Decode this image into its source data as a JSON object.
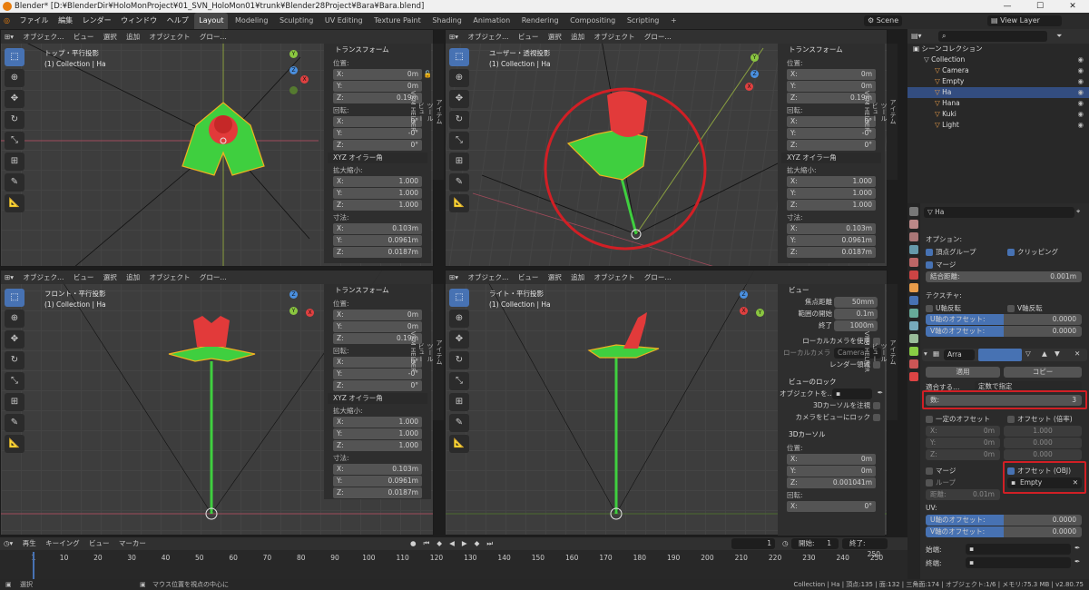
{
  "titlebar": {
    "title": "Blender* [D:¥BlenderDir¥HoloMonProject¥01_SVN_HoloMon01¥trunk¥Blender28Project¥Bara¥Bara.blend]",
    "minimize": "—",
    "maximize": "☐",
    "close": "✕"
  },
  "menubar": {
    "menus": [
      "ファイル",
      "編集",
      "レンダー",
      "ウィンドウ",
      "ヘルプ"
    ],
    "tabs": [
      "Layout",
      "Modeling",
      "Sculpting",
      "UV Editing",
      "Texture Paint",
      "Shading",
      "Animation",
      "Rendering",
      "Compositing",
      "Scripting"
    ],
    "add_tab": "+",
    "scene": "Scene",
    "view_layer": "View Layer"
  },
  "viewport_header": {
    "mode": "オブジェク…",
    "mode_long": "オブジェクト…",
    "view": "ビュー",
    "select": "選択",
    "add": "追加",
    "object": "オブジェクト",
    "orientation": "グロー…",
    "pivot": "グロー…"
  },
  "viewports": {
    "tl": {
      "title": "トップ・平行投影",
      "collection": "(1) Collection | Ha"
    },
    "tr": {
      "title": "ユーザー・透視投影",
      "collection": "(1) Collection | Ha"
    },
    "bl": {
      "title": "フロント・平行投影",
      "collection": "(1) Collection | Ha"
    },
    "br": {
      "title": "ライト・平行投影",
      "collection": "(1) Collection | Ha"
    }
  },
  "transform_panel": {
    "header": "トランスフォーム",
    "location_label": "位置:",
    "location": [
      {
        "k": "X:",
        "v": "0m"
      },
      {
        "k": "Y:",
        "v": "0m"
      },
      {
        "k": "Z:",
        "v": "0.19m"
      }
    ],
    "rotation_label": "回転:",
    "rotation": [
      {
        "k": "X:",
        "v": "0°"
      },
      {
        "k": "Y:",
        "v": "-0°"
      },
      {
        "k": "Z:",
        "v": "0°"
      }
    ],
    "rotation_mode": "XYZ オイラー角",
    "scale_label": "拡大縮小:",
    "scale": [
      {
        "k": "X:",
        "v": "1.000"
      },
      {
        "k": "Y:",
        "v": "1.000"
      },
      {
        "k": "Z:",
        "v": "1.000"
      }
    ],
    "dimensions_label": "寸法:",
    "dimensions": [
      {
        "k": "X:",
        "v": "0.103m"
      },
      {
        "k": "Y:",
        "v": "0.0961m"
      },
      {
        "k": "Z:",
        "v": "0.0187m"
      }
    ]
  },
  "side_tabs": {
    "item": "アイテム",
    "tool": "ツール",
    "view": "ビュー",
    "vrm": "VRM HELPER"
  },
  "view_panel": {
    "header": "ビュー",
    "focal_label": "焦点距離",
    "focal": "50mm",
    "clip_start_label": "範囲の開始",
    "clip_start": "0.1m",
    "clip_end_label": "終了",
    "clip_end": "1000m",
    "local_camera_label": "ローカルカメラを使用",
    "local_camera_field_label": "ローカルカメラ",
    "local_camera_value": "Camera",
    "render_region_label": "レンダー領域",
    "lock_header": "ビューのロック",
    "lock_object_label": "オブジェクトを…",
    "lock_cursor_label": "3Dカーソルを注視",
    "lock_camera_label": "カメラをビューにロック",
    "cursor_header": "3Dカーソル",
    "cursor_location_label": "位置:",
    "cursor_location": [
      {
        "k": "X:",
        "v": "0m"
      },
      {
        "k": "Y:",
        "v": "0m"
      },
      {
        "k": "Z:",
        "v": "0.001041m"
      }
    ],
    "cursor_rotation_label": "回転:",
    "cursor_rotation": [
      {
        "k": "X:",
        "v": "0°"
      }
    ]
  },
  "timeline": {
    "playback": "再生",
    "keying": "キーイング",
    "view": "ビュー",
    "marker": "マーカー",
    "current_frame": "1",
    "start_label": "開始:",
    "start": "1",
    "end_label": "終了:",
    "end": "250",
    "ticks": [
      "1",
      "10",
      "20",
      "30",
      "40",
      "50",
      "60",
      "70",
      "80",
      "90",
      "100",
      "110",
      "120",
      "130",
      "140",
      "150",
      "160",
      "170",
      "180",
      "190",
      "200",
      "210",
      "220",
      "230",
      "240",
      "250"
    ]
  },
  "statusbar": {
    "select": "選択",
    "hint": "マウス位置を視点の中心に",
    "stats": "Collection | Ha | 頂点:135 | 面:132 | 三角面:174 | オブジェクト:1/6 | メモリ:75.3 MB | v2.80.75"
  },
  "outliner": {
    "scene_collection": "シーンコレクション",
    "items": [
      {
        "name": "Collection",
        "depth": 1,
        "color": "#bbbbbb"
      },
      {
        "name": "Camera",
        "depth": 2,
        "color": "#e89c4a"
      },
      {
        "name": "Empty",
        "depth": 2,
        "color": "#e89c4a"
      },
      {
        "name": "Ha",
        "depth": 2,
        "color": "#e89c4a",
        "selected": true
      },
      {
        "name": "Hana",
        "depth": 2,
        "color": "#e89c4a"
      },
      {
        "name": "Kuki",
        "depth": 2,
        "color": "#e89c4a"
      },
      {
        "name": "Light",
        "depth": 2,
        "color": "#e89c4a"
      }
    ]
  },
  "properties": {
    "object_name": "Ha",
    "options_label": "オプション:",
    "vertex_groups": "頂点グループ",
    "clipping": "クリッピング",
    "merge": "マージ",
    "merge_distance_label": "結合距離:",
    "merge_distance": "0.001m",
    "texture_label": "テクスチャ:",
    "flip_u": "U軸反転",
    "flip_v": "V軸反転",
    "u_offset_label": "U軸のオフセット:",
    "u_offset": "0.0000",
    "v_offset_label": "V軸のオフセット:",
    "v_offset": "0.0000",
    "modifier_name": "Arra",
    "apply": "適用",
    "copy": "コピー",
    "fit_type_label": "適合する…",
    "fit_type": "定数で指定",
    "count_label": "数:",
    "count": "3",
    "constant_offset": "一定のオフセット",
    "relative_offset": "オフセット (倍率)",
    "const_xyz": [
      {
        "k": "X:",
        "v": "0m"
      },
      {
        "k": "Y:",
        "v": "0m"
      },
      {
        "k": "Z:",
        "v": "0m"
      }
    ],
    "rel_xyz": [
      "1.000",
      "0.000",
      "0.000"
    ],
    "merge2": "マージ",
    "loop": "ループ",
    "distance_label": "距離:",
    "distance": "0.01m",
    "object_offset": "オフセット (OBJ)",
    "object_offset_value": "Empty",
    "uv_label": "UV:",
    "u_offset2_label": "U軸のオフセット:",
    "u_offset2": "0.0000",
    "v_offset2_label": "V軸のオフセット:",
    "v_offset2": "0.0000",
    "start_cap_label": "始端:",
    "end_cap_label": "終端:"
  },
  "colors": {
    "accent": "#4772b3",
    "highlight": "#d11f25",
    "leaf": "#3fcf3f",
    "petal": "#e23a3a"
  }
}
